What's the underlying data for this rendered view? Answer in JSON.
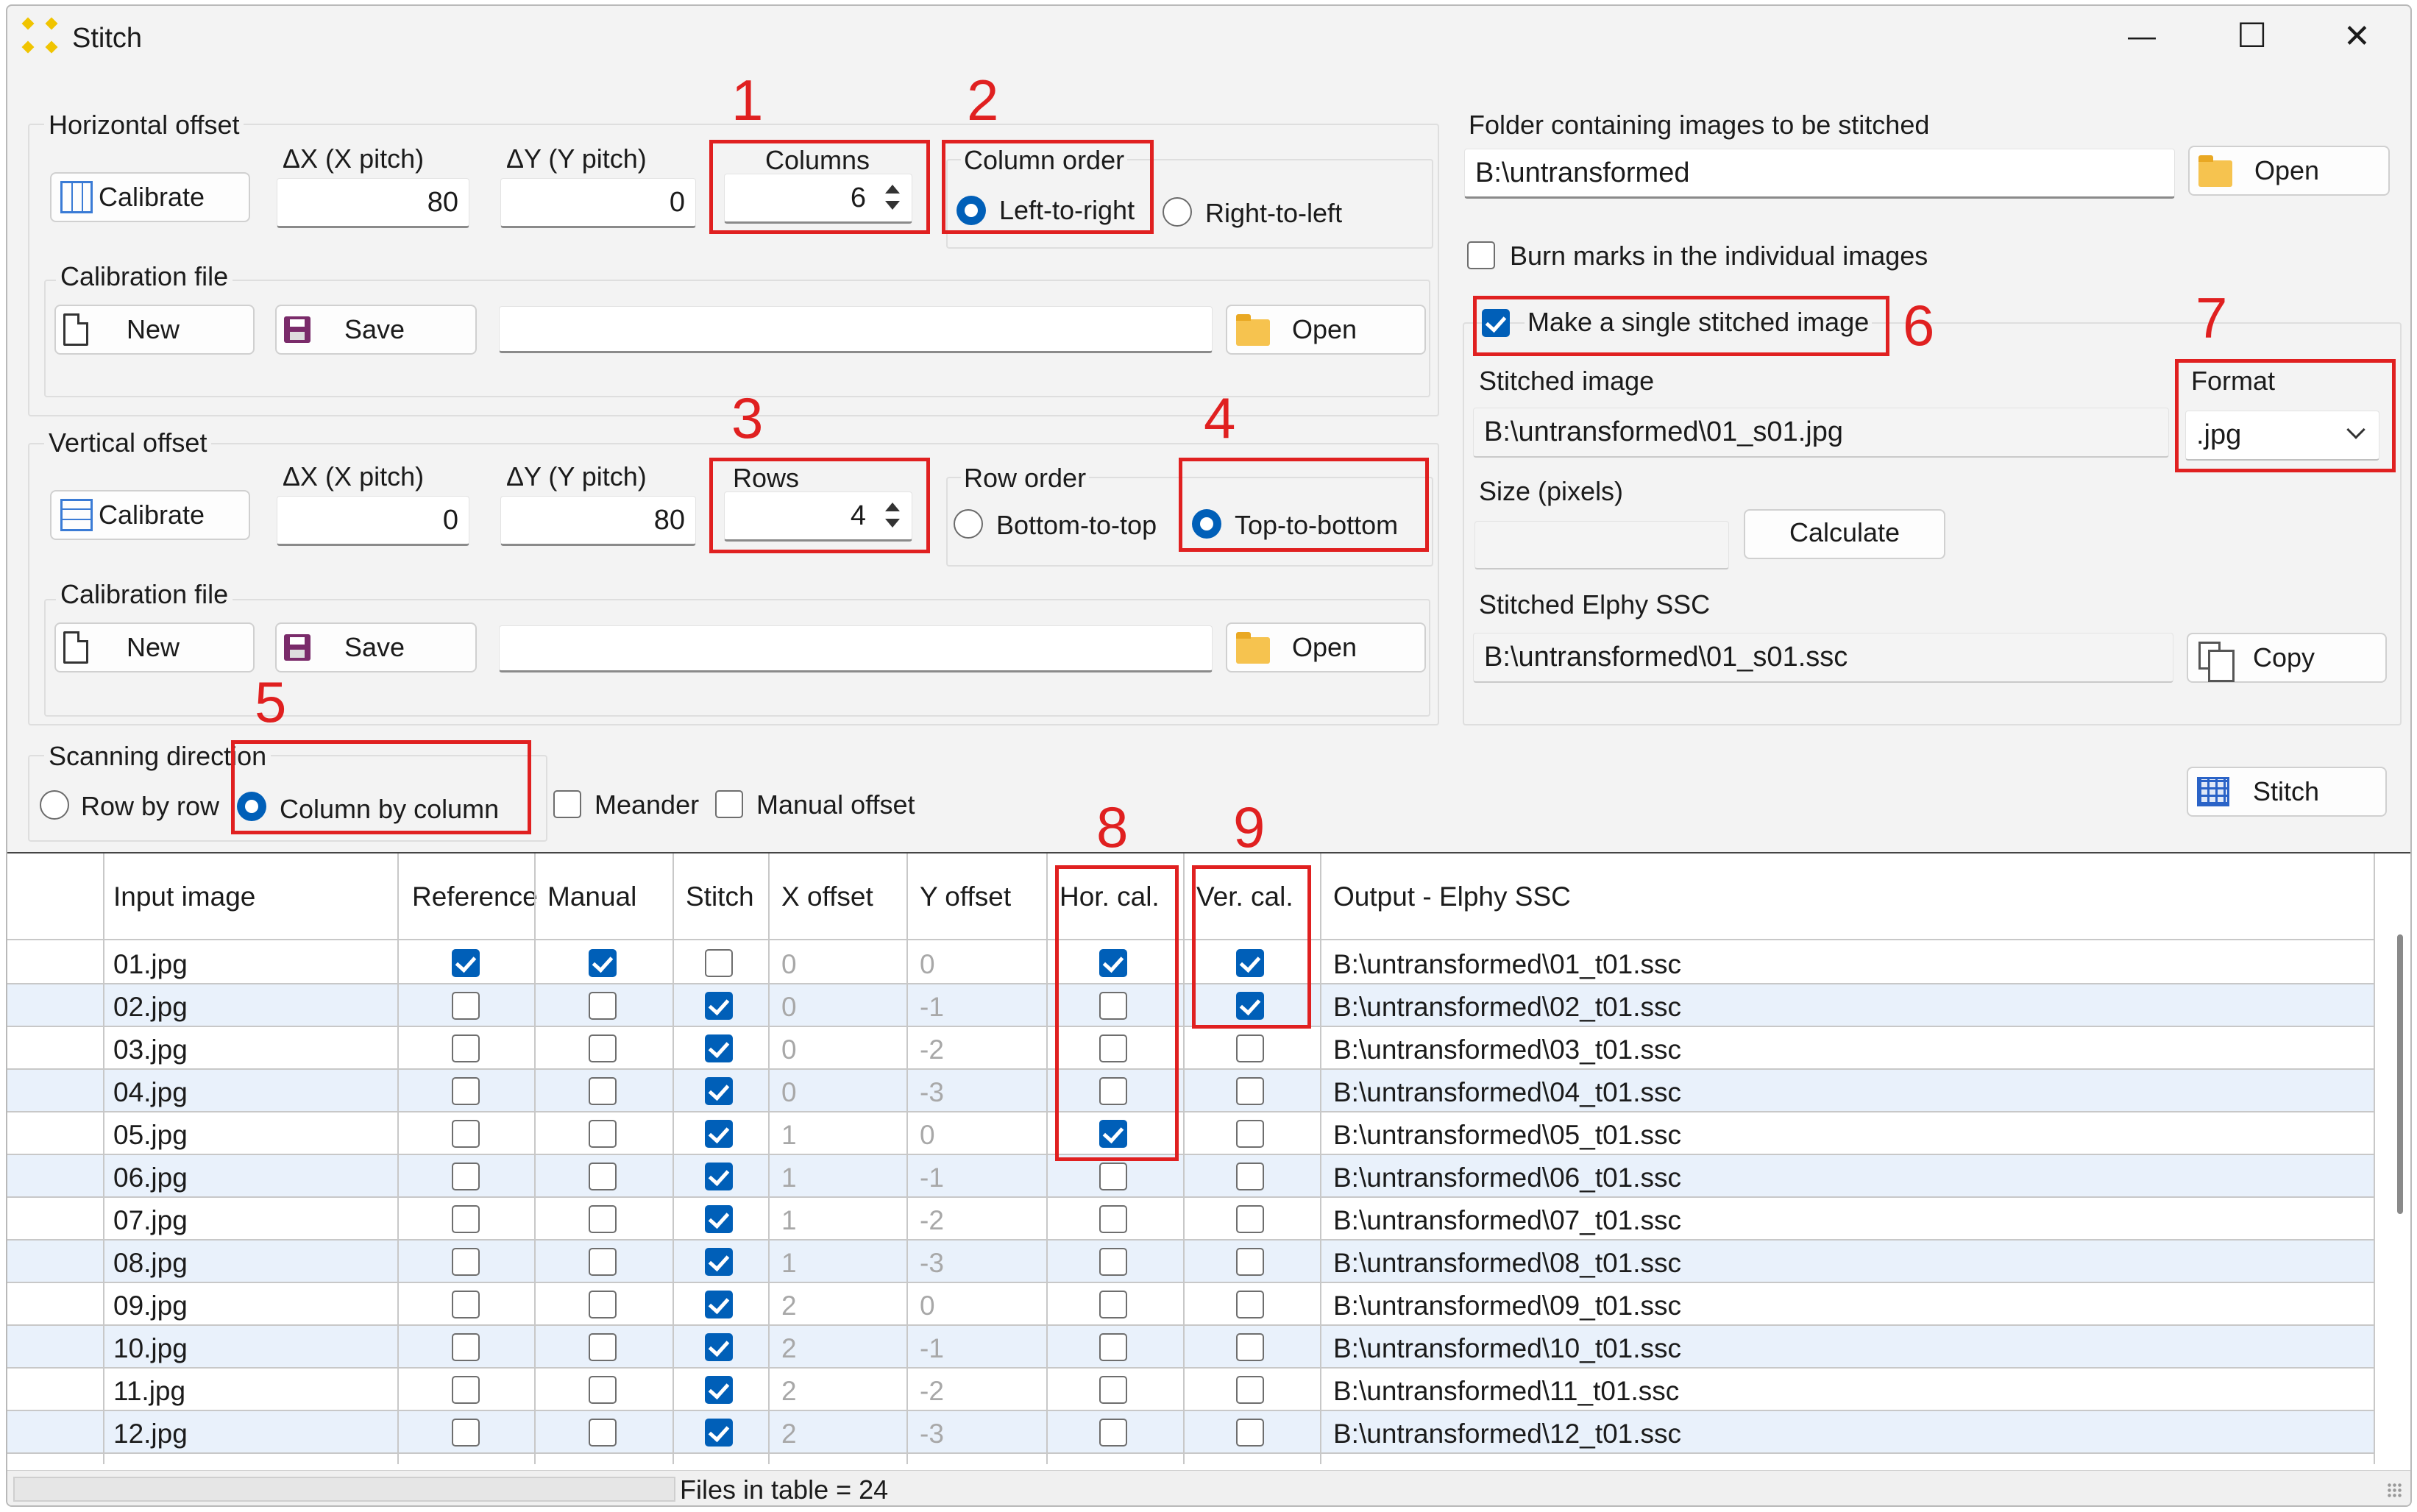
{
  "window": {
    "title": "Stitch",
    "controls": {
      "minimize": "—",
      "maximize": "☐",
      "close": "✕"
    }
  },
  "horizontal": {
    "group": "Horizontal offset",
    "calibrate": "Calibrate",
    "dx_label": "ΔX (X pitch)",
    "dx": "80",
    "dy_label": "ΔY (Y pitch)",
    "dy": "0",
    "columns_label": "Columns",
    "columns": "6",
    "col_order_label": "Column order",
    "ltr": "Left-to-right",
    "rtl": "Right-to-left",
    "cal_file": "Calibration file",
    "new": "New",
    "save": "Save",
    "open": "Open"
  },
  "vertical": {
    "group": "Vertical offset",
    "calibrate": "Calibrate",
    "dx_label": "ΔX (X pitch)",
    "dx": "0",
    "dy_label": "ΔY (Y pitch)",
    "dy": "80",
    "rows_label": "Rows",
    "rows": "4",
    "row_order_label": "Row order",
    "btt": "Bottom-to-top",
    "ttb": "Top-to-bottom",
    "cal_file": "Calibration file",
    "new": "New",
    "save": "Save",
    "open": "Open"
  },
  "scan": {
    "group": "Scanning direction",
    "row": "Row by row",
    "col": "Column by column",
    "meander": "Meander",
    "manual": "Manual offset"
  },
  "right": {
    "folder_label": "Folder containing images to be stitched",
    "folder": "B:\\untransformed",
    "open": "Open",
    "burn": "Burn marks in the individual images",
    "single": "Make a single stitched image",
    "stitched_label": "Stitched image",
    "stitched": "B:\\untransformed\\01_s01.jpg",
    "format_label": "Format",
    "format": ".jpg",
    "size_label": "Size (pixels)",
    "size": "",
    "calculate": "Calculate",
    "ssc_label": "Stitched Elphy SSC",
    "ssc": "B:\\untransformed\\01_s01.ssc",
    "copy": "Copy",
    "stitch": "Stitch"
  },
  "annotations": [
    "1",
    "2",
    "3",
    "4",
    "5",
    "6",
    "7",
    "8",
    "9"
  ],
  "table": {
    "headers": [
      "Input image",
      "Reference",
      "Manual",
      "Stitch",
      "X offset",
      "Y offset",
      "Hor. cal.",
      "Ver. cal.",
      "Output - Elphy SSC"
    ],
    "rows": [
      {
        "img": "01.jpg",
        "ref": true,
        "man": true,
        "st": false,
        "x": "0",
        "y": "0",
        "hc": true,
        "vc": true,
        "out": "B:\\untransformed\\01_t01.ssc"
      },
      {
        "img": "02.jpg",
        "ref": false,
        "man": false,
        "st": true,
        "x": "0",
        "y": "-1",
        "hc": false,
        "vc": true,
        "out": "B:\\untransformed\\02_t01.ssc"
      },
      {
        "img": "03.jpg",
        "ref": false,
        "man": false,
        "st": true,
        "x": "0",
        "y": "-2",
        "hc": false,
        "vc": false,
        "out": "B:\\untransformed\\03_t01.ssc"
      },
      {
        "img": "04.jpg",
        "ref": false,
        "man": false,
        "st": true,
        "x": "0",
        "y": "-3",
        "hc": false,
        "vc": false,
        "out": "B:\\untransformed\\04_t01.ssc"
      },
      {
        "img": "05.jpg",
        "ref": false,
        "man": false,
        "st": true,
        "x": "1",
        "y": "0",
        "hc": true,
        "vc": false,
        "out": "B:\\untransformed\\05_t01.ssc"
      },
      {
        "img": "06.jpg",
        "ref": false,
        "man": false,
        "st": true,
        "x": "1",
        "y": "-1",
        "hc": false,
        "vc": false,
        "out": "B:\\untransformed\\06_t01.ssc"
      },
      {
        "img": "07.jpg",
        "ref": false,
        "man": false,
        "st": true,
        "x": "1",
        "y": "-2",
        "hc": false,
        "vc": false,
        "out": "B:\\untransformed\\07_t01.ssc"
      },
      {
        "img": "08.jpg",
        "ref": false,
        "man": false,
        "st": true,
        "x": "1",
        "y": "-3",
        "hc": false,
        "vc": false,
        "out": "B:\\untransformed\\08_t01.ssc"
      },
      {
        "img": "09.jpg",
        "ref": false,
        "man": false,
        "st": true,
        "x": "2",
        "y": "0",
        "hc": false,
        "vc": false,
        "out": "B:\\untransformed\\09_t01.ssc"
      },
      {
        "img": "10.jpg",
        "ref": false,
        "man": false,
        "st": true,
        "x": "2",
        "y": "-1",
        "hc": false,
        "vc": false,
        "out": "B:\\untransformed\\10_t01.ssc"
      },
      {
        "img": "11.jpg",
        "ref": false,
        "man": false,
        "st": true,
        "x": "2",
        "y": "-2",
        "hc": false,
        "vc": false,
        "out": "B:\\untransformed\\11_t01.ssc"
      },
      {
        "img": "12.jpg",
        "ref": false,
        "man": false,
        "st": true,
        "x": "2",
        "y": "-3",
        "hc": false,
        "vc": false,
        "out": "B:\\untransformed\\12_t01.ssc"
      }
    ]
  },
  "status": "Files in table = 24",
  "colors": {
    "accent": "#005fb8",
    "annotation": "#e02020",
    "alt_row": "#e9f1fb"
  }
}
